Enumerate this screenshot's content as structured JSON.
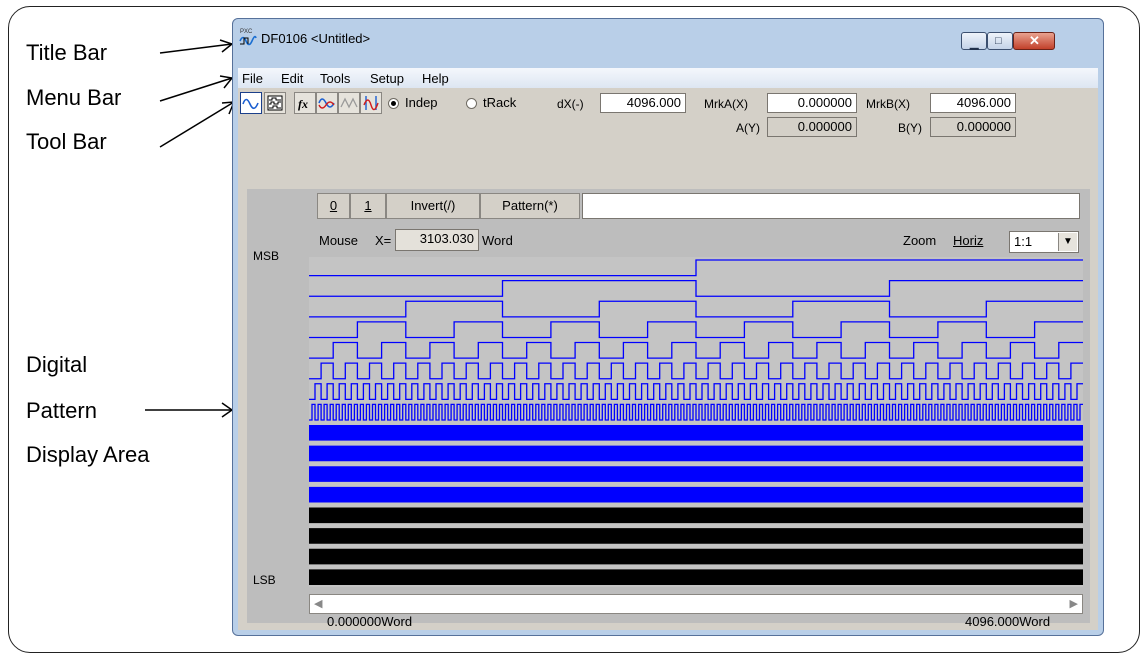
{
  "callouts": {
    "title_bar": "Title Bar",
    "menu_bar": "Menu Bar",
    "tool_bar": "Tool Bar",
    "digital": "Digital",
    "pattern": "Pattern",
    "display_area": "Display Area"
  },
  "window": {
    "title": "DF0106 <Untitled>"
  },
  "menu": [
    "File",
    "Edit",
    "Tools",
    "Setup",
    "Help"
  ],
  "toolbar": {
    "icons": [
      "sine-wave-icon",
      "digital-pattern-icon",
      "function-fx-icon",
      "waveform-add-icon",
      "triangle-wave-icon",
      "marker-wave-icon"
    ],
    "indep_label": "Indep",
    "track_label": "tRack",
    "mode_selected": "Indep",
    "dx_label": "dX(-)",
    "dx_value": "4096.000",
    "mrka_x_label": "MrkA(X)",
    "mrka_x_value": "0.000000",
    "mrkb_x_label": "MrkB(X)",
    "mrkb_x_value": "4096.000",
    "a_y_label": "A(Y)",
    "a_y_value": "0.000000",
    "b_y_label": "B(Y)",
    "b_y_value": "0.000000"
  },
  "pattern_bar": {
    "zero": "0",
    "one": "1",
    "invert": "Invert(/)",
    "pattern": "Pattern(*)",
    "input_value": ""
  },
  "display": {
    "mouse_label": "Mouse",
    "x_label": "X=",
    "x_value": "3103.030",
    "unit": "Word",
    "zoom_label": "Zoom",
    "horiz_label": "Horiz",
    "zoom_value": "1:1",
    "msb": "MSB",
    "lsb": "LSB",
    "x_start": "0.000000Word",
    "x_end": "4096.000Word"
  },
  "colors": {
    "wave_blue": "#0000ff",
    "wave_black": "#000000",
    "wave_bg": "#c4c4c4"
  }
}
